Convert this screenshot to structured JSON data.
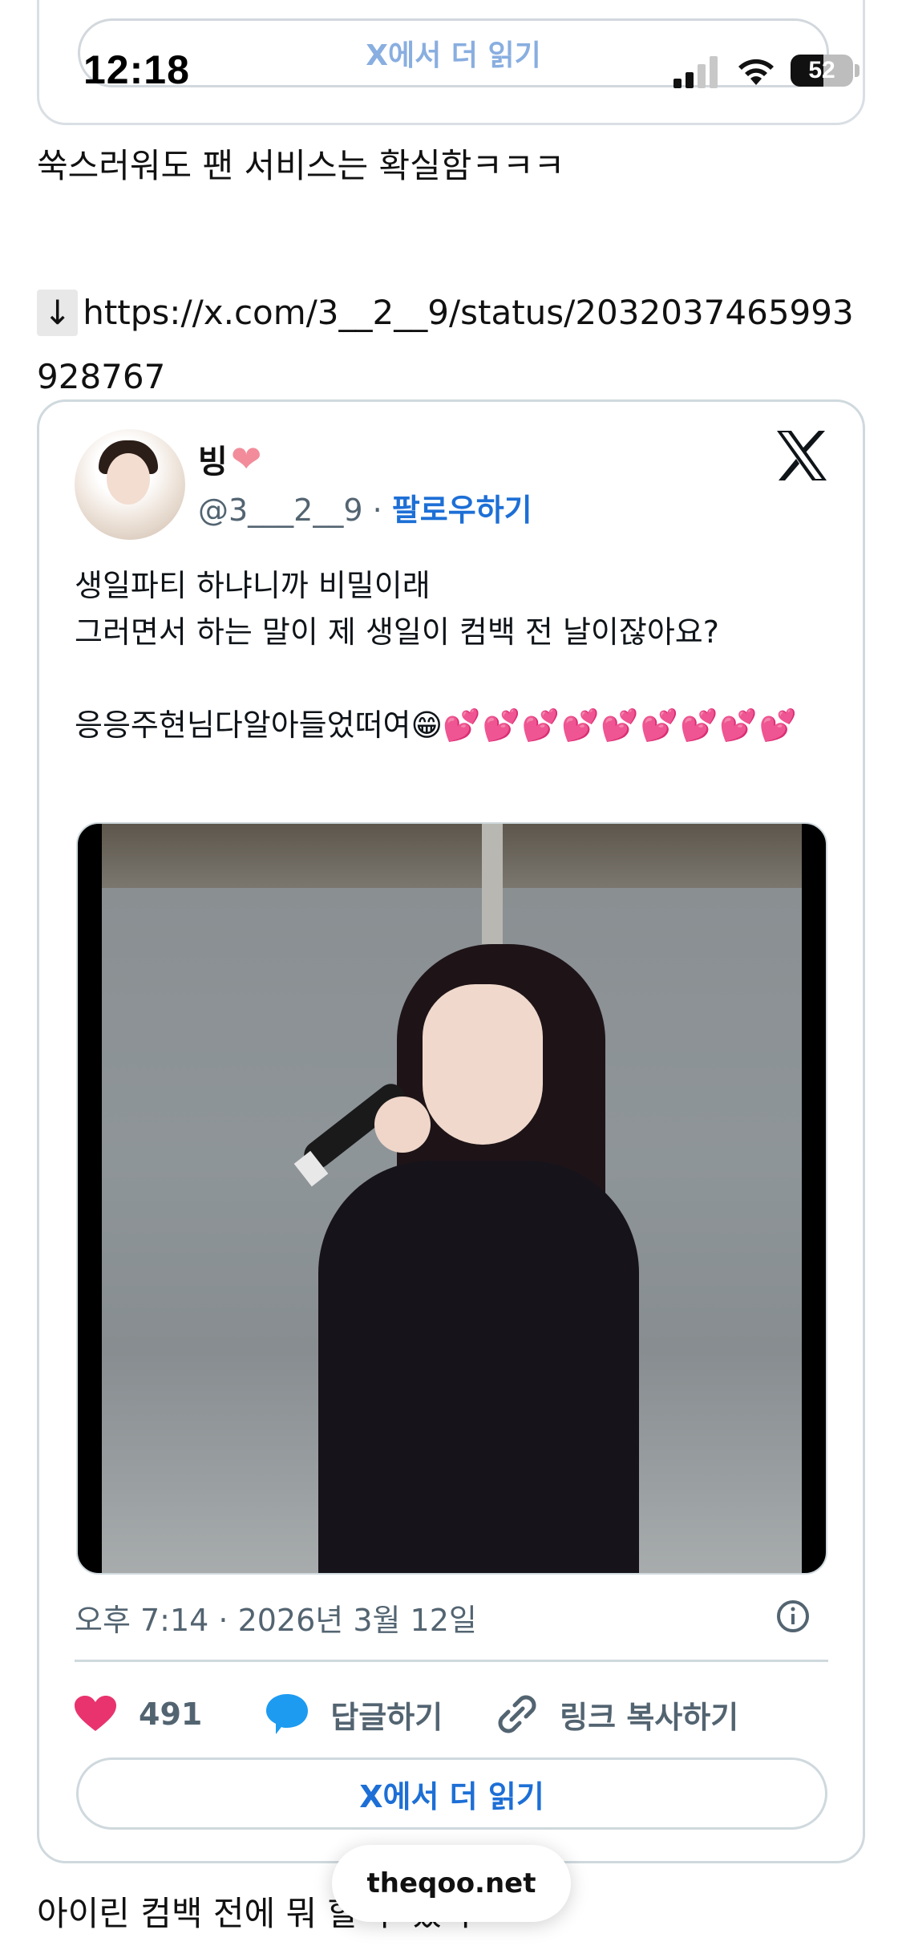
{
  "status_bar": {
    "time": "12:18",
    "battery_level": "52",
    "battery_fraction": 0.52
  },
  "prev_embed": {
    "read_more_label": "X에서 더 읽기"
  },
  "post": {
    "line1": "쑥스러워도 팬 서비스는 확실함ㅋㅋㅋ",
    "arrow": "↓",
    "link": "https://x.com/3__2__9/status/2032037465993928767",
    "after_text": "아이린 컴백 전에 뭐 할 수 있나 ㅋㅋ"
  },
  "tweet": {
    "display_name": "빙",
    "name_emoji": "❤",
    "handle": "@3___2__9",
    "separator": "·",
    "follow_label": "팔로우하기",
    "text_line1": "생일파티 하냐니까 비밀이래",
    "text_line2": "그러면서 하는 말이 제 생일이 컴백 전 날이잖아요?",
    "text_line3": "응응주현님다알아들었떠여",
    "grin_emoji": "😁",
    "hearts": "💕💕💕💕💕💕💕💕💕",
    "timestamp": "오후 7:14 · 2026년 3월 12일",
    "like_count": "491",
    "reply_label": "답글하기",
    "copy_link_label": "링크 복사하기",
    "read_more_label": "X에서 더 읽기"
  },
  "browser": {
    "url": "theqoo.net"
  },
  "colors": {
    "link_blue": "#1d6fd6",
    "like_pink": "#e8336e",
    "reply_blue": "#1d9bf0",
    "border": "#cfd9de"
  }
}
